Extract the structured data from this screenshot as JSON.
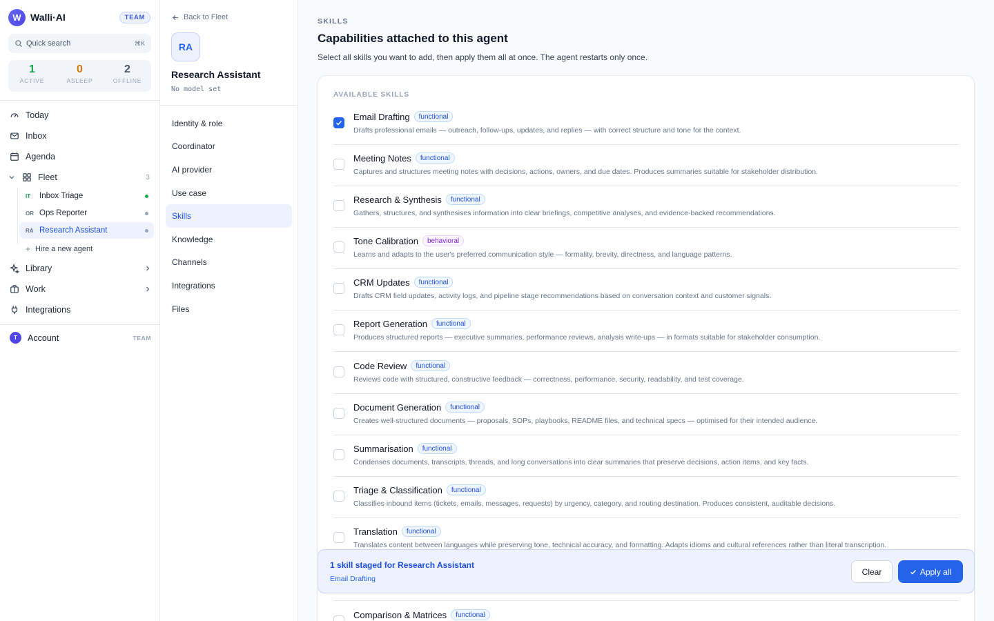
{
  "brand": {
    "logo_letter": "W",
    "name": "Walli·AI",
    "badge": "TEAM"
  },
  "search": {
    "placeholder": "Quick search",
    "shortcut": "⌘K"
  },
  "stats": [
    {
      "value": "1",
      "label": "ACTIVE",
      "color": "#16a34a"
    },
    {
      "value": "0",
      "label": "ASLEEP",
      "color": "#d97706"
    },
    {
      "value": "2",
      "label": "OFFLINE",
      "color": "#475569"
    }
  ],
  "nav": {
    "today": "Today",
    "inbox": "Inbox",
    "agenda": "Agenda",
    "fleet": {
      "label": "Fleet",
      "count": "3"
    },
    "fleet_items": [
      {
        "initials": "IT",
        "label": "Inbox Triage",
        "status": "online"
      },
      {
        "initials": "OR",
        "label": "Ops Reporter",
        "status": "offline"
      },
      {
        "initials": "RA",
        "label": "Research Assistant",
        "status": "offline"
      }
    ],
    "hire": "Hire a new agent",
    "library": "Library",
    "work": "Work",
    "integrations": "Integrations"
  },
  "account": {
    "initial": "T",
    "label": "Account",
    "tag": "TEAM"
  },
  "agent": {
    "back": "Back to Fleet",
    "initials": "RA",
    "name": "Research Assistant",
    "model": "No model set",
    "menu": [
      "Identity & role",
      "Coordinator",
      "AI provider",
      "Use case",
      "Skills",
      "Knowledge",
      "Channels",
      "Integrations",
      "Files"
    ],
    "active_menu": "Skills"
  },
  "main": {
    "eyebrow": "SKILLS",
    "title": "Capabilities attached to this agent",
    "subtitle": "Select all skills you want to add, then apply them all at once. The agent restarts only once.",
    "card_label": "AVAILABLE SKILLS"
  },
  "skills": [
    {
      "name": "Email Drafting",
      "tag": "functional",
      "checked": true,
      "desc": "Drafts professional emails — outreach, follow-ups, updates, and replies — with correct structure and tone for the context."
    },
    {
      "name": "Meeting Notes",
      "tag": "functional",
      "checked": false,
      "desc": "Captures and structures meeting notes with decisions, actions, owners, and due dates. Produces summaries suitable for stakeholder distribution."
    },
    {
      "name": "Research & Synthesis",
      "tag": "functional",
      "checked": false,
      "desc": "Gathers, structures, and synthesises information into clear briefings, competitive analyses, and evidence-backed recommendations."
    },
    {
      "name": "Tone Calibration",
      "tag": "behavioral",
      "checked": false,
      "desc": "Learns and adapts to the user's preferred communication style — formality, brevity, directness, and language patterns."
    },
    {
      "name": "CRM Updates",
      "tag": "functional",
      "checked": false,
      "desc": "Drafts CRM field updates, activity logs, and pipeline stage recommendations based on conversation context and customer signals."
    },
    {
      "name": "Report Generation",
      "tag": "functional",
      "checked": false,
      "desc": "Produces structured reports — executive summaries, performance reviews, analysis write-ups — in formats suitable for stakeholder consumption."
    },
    {
      "name": "Code Review",
      "tag": "functional",
      "checked": false,
      "desc": "Reviews code with structured, constructive feedback — correctness, performance, security, readability, and test coverage."
    },
    {
      "name": "Document Generation",
      "tag": "functional",
      "checked": false,
      "desc": "Creates well-structured documents — proposals, SOPs, playbooks, README files, and technical specs — optimised for their intended audience."
    },
    {
      "name": "Summarisation",
      "tag": "functional",
      "checked": false,
      "desc": "Condenses documents, transcripts, threads, and long conversations into clear summaries that preserve decisions, action items, and key facts."
    },
    {
      "name": "Triage & Classification",
      "tag": "functional",
      "checked": false,
      "desc": "Classifies inbound items (tickets, emails, messages, requests) by urgency, category, and routing destination. Produces consistent, auditable decisions."
    },
    {
      "name": "Translation",
      "tag": "functional",
      "checked": false,
      "desc": "Translates content between languages while preserving tone, technical accuracy, and formatting. Adapts idioms and cultural references rather than literal transcription."
    },
    {
      "name": "Comparison & Matrices",
      "tag": "functional",
      "checked": false,
      "desc": ""
    }
  ],
  "staged": {
    "title": "1 skill staged for Research Assistant",
    "items": "Email Drafting",
    "clear": "Clear",
    "apply": "Apply all"
  }
}
